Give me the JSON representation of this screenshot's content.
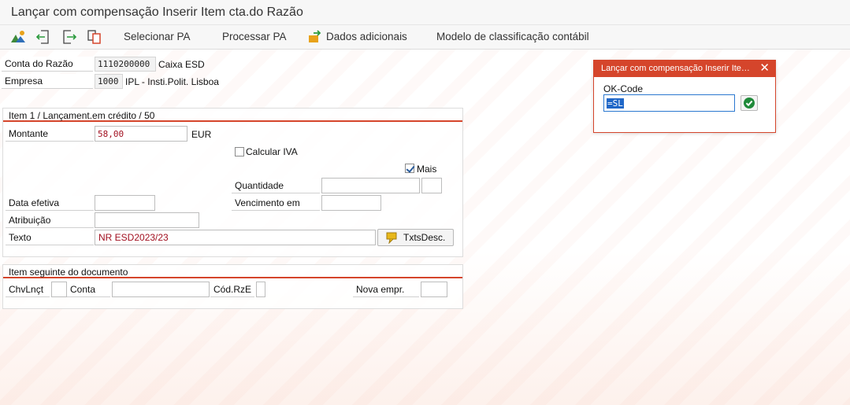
{
  "window": {
    "title": "Lançar com compensação Inserir Item cta.do Razão"
  },
  "toolbar": {
    "icons": [
      "mountains-icon",
      "arrow-left-page-icon",
      "arrow-right-page-icon",
      "copy-document-icon"
    ],
    "select_pa": "Selecionar PA",
    "process_pa": "Processar PA",
    "additional_data": "Dados adicionais",
    "classification_model": "Modelo de classificação contábil"
  },
  "header": {
    "gl_account_label": "Conta do Razão",
    "gl_account_value": "1110200000",
    "gl_account_text": "Caixa ESD",
    "company_label": "Empresa",
    "company_value": "1000",
    "company_text": "IPL - Insti.Polit. Lisboa"
  },
  "item_group": {
    "title": "Item 1 / Lançament.em crédito / 50",
    "amount_label": "Montante",
    "amount_value": "58,00",
    "currency": "EUR",
    "calc_tax_label": "Calcular IVA",
    "calc_tax_checked": false,
    "more_label": "Mais",
    "more_checked": true,
    "quantity_label": "Quantidade",
    "quantity_value": "",
    "quantity_unit": "",
    "value_date_label": "Data efetiva",
    "value_date_value": "",
    "due_date_label": "Vencimento em",
    "due_date_value": "",
    "assignment_label": "Atribuição",
    "assignment_value": "",
    "text_label": "Texto",
    "text_value": "NR ESD2023/23",
    "long_text_button": "TxtsDesc."
  },
  "next_item_group": {
    "title": "Item seguinte do documento",
    "posting_key_label": "ChvLnçt",
    "posting_key_value": "",
    "account_label": "Conta",
    "account_value": "",
    "special_gl_label": "Cód.RzE",
    "special_gl_value": "",
    "new_company_label": "Nova empr.",
    "new_company_value": ""
  },
  "popup": {
    "title": "Lançar com compensação Inserir Item cta.do Razão",
    "okcode_label": "OK-Code",
    "okcode_value": "=SL"
  },
  "colors": {
    "accent": "#d5452b",
    "input_text": "#a10f1f",
    "selection": "#1f67c8",
    "ok_green": "#1f8a3a"
  }
}
